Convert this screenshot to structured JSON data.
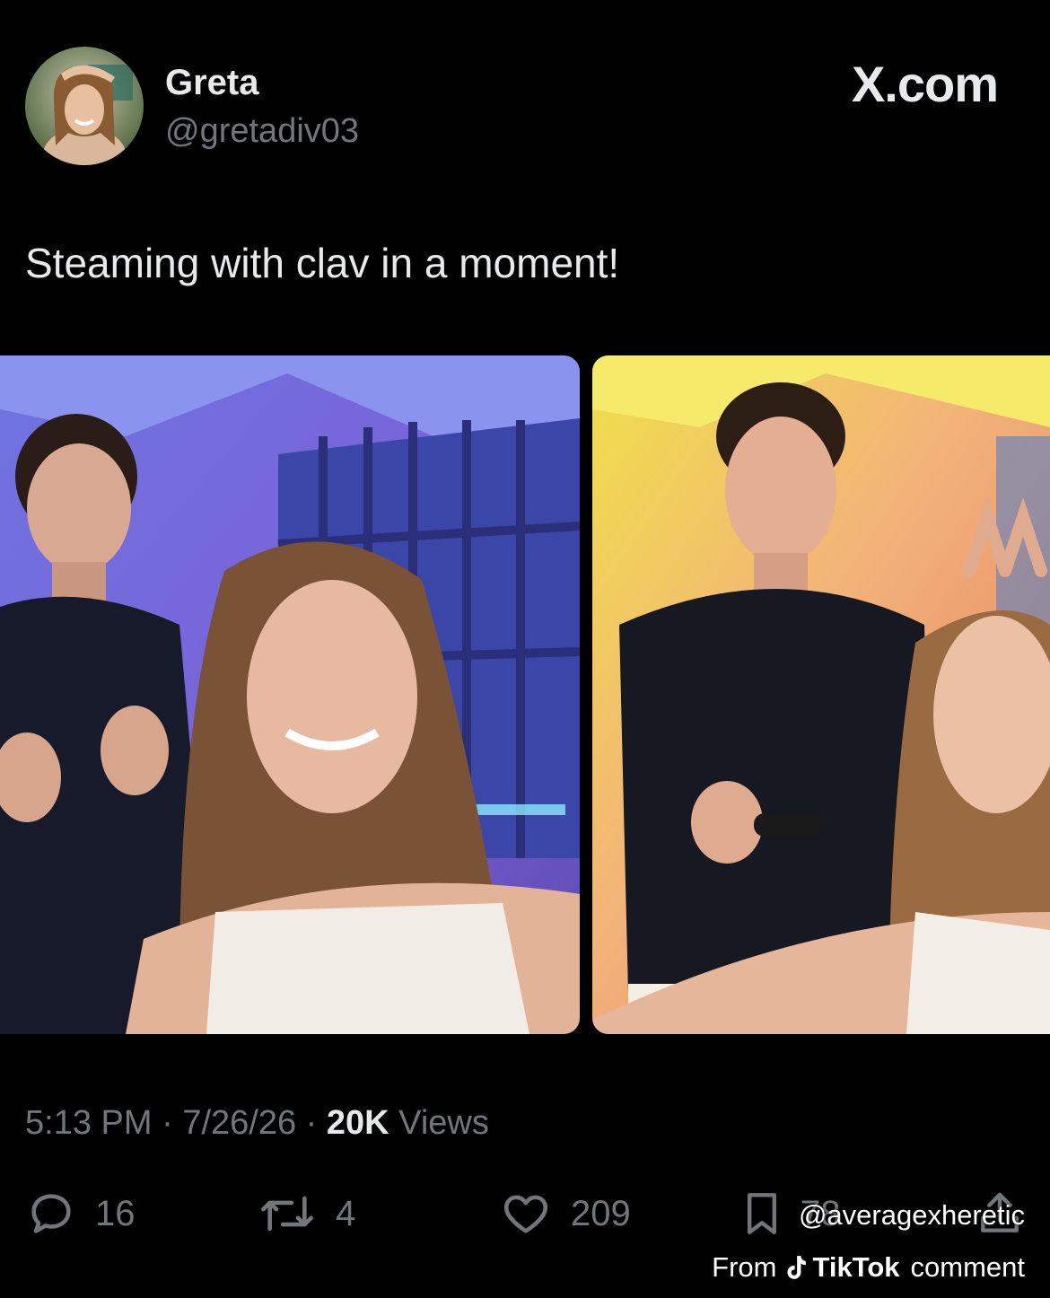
{
  "author": {
    "display_name": "Greta",
    "handle": "@gretadiv03",
    "avatar_icon": "profile-photo"
  },
  "brand": "X.com",
  "tweet": {
    "text": "Steaming with clav in a moment!"
  },
  "meta": {
    "time": "5:13 PM",
    "sep1": "·",
    "date": "7/26/26",
    "sep2": "·",
    "views_count": "20K",
    "views_label": "Views"
  },
  "actions": {
    "replies": "16",
    "reposts": "4",
    "likes": "209",
    "bookmarks": "78"
  },
  "overlay": {
    "username": "@averagexheretic",
    "from": "From",
    "platform": "TikTok",
    "suffix": "comment"
  },
  "colors": {
    "background": "#000000",
    "text_primary": "#e7e9ea",
    "text_secondary": "#71767b"
  }
}
